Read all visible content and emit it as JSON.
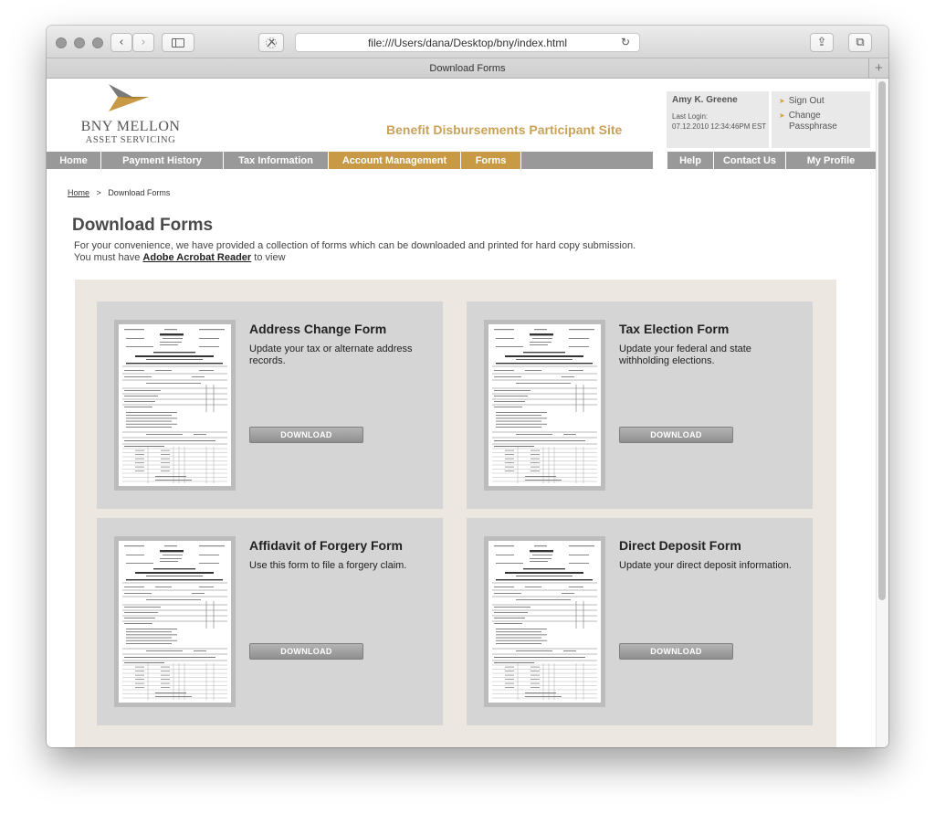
{
  "browser": {
    "url": "file:///Users/dana/Desktop/bny/index.html",
    "tab_title": "Download Forms",
    "back_glyph": "‹",
    "forward_glyph": "›",
    "reload_glyph": "↻",
    "share_glyph": "⇪",
    "tabs_glyph": "⧉",
    "new_tab_glyph": "+"
  },
  "site": {
    "logo_name": "BNY MELLON",
    "logo_sub": "ASSET SERVICING",
    "title": "Benefit Disbursements Participant Site",
    "brand_gold": "#c89a46",
    "nav_grey": "#999999"
  },
  "user": {
    "name": "Amy K. Greene",
    "last_login_label": "Last Login:",
    "last_login_value": "07.12.2010  12:34:46PM EST",
    "sign_out": "Sign Out",
    "change_passphrase_1": "Change",
    "change_passphrase_2": "Passphrase",
    "arrow": "➤"
  },
  "nav": {
    "items": [
      {
        "label": "Home",
        "active": false
      },
      {
        "label": "Payment History",
        "active": false
      },
      {
        "label": "Tax Information",
        "active": false
      },
      {
        "label": "Account Management",
        "active": true
      },
      {
        "label": "Forms",
        "active": true
      }
    ],
    "right_items": [
      "Help",
      "Contact Us",
      "My Profile"
    ]
  },
  "breadcrumb": {
    "home": "Home",
    "separator": ">",
    "current": "Download Forms"
  },
  "page": {
    "heading": "Download Forms",
    "intro_line1": "For your convenience, we have provided a collection of forms which can be downloaded and printed for hard copy submission.",
    "intro_line2_pre": "You must have ",
    "intro_link": "Adobe Acrobat Reader",
    "intro_line2_post": " to view"
  },
  "forms": [
    {
      "title": "Address Change Form",
      "description": "Update your tax or alternate address records.",
      "button": "DOWNLOAD"
    },
    {
      "title": "Tax Election Form",
      "description": "Update your federal and state withholding elections.",
      "button": "DOWNLOAD"
    },
    {
      "title": "Affidavit of Forgery Form",
      "description": "Use this form to file a forgery claim.",
      "button": "DOWNLOAD"
    },
    {
      "title": "Direct Deposit Form",
      "description": "Update your direct deposit information.",
      "button": "DOWNLOAD"
    }
  ]
}
